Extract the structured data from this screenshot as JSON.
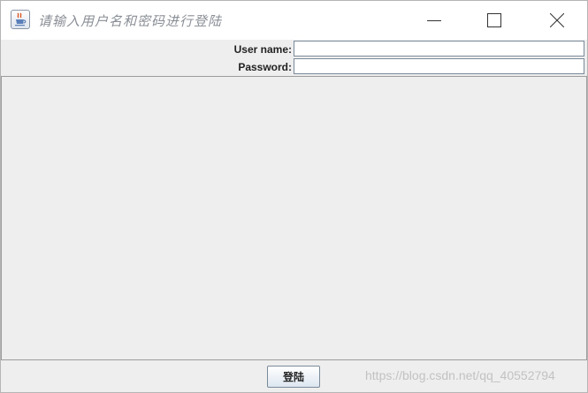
{
  "window": {
    "title": "请输入用户名和密码进行登陆",
    "app_icon": "java-cup-icon",
    "controls": {
      "minimize_icon": "minimize-icon",
      "maximize_icon": "maximize-icon",
      "close_icon": "close-icon"
    }
  },
  "form": {
    "username_label": "User name:",
    "username_value": "",
    "password_label": "Password:",
    "password_value": ""
  },
  "footer": {
    "login_button_label": "登陆"
  },
  "watermark": {
    "text": "https://blog.csdn.net/qq_40552794"
  }
}
